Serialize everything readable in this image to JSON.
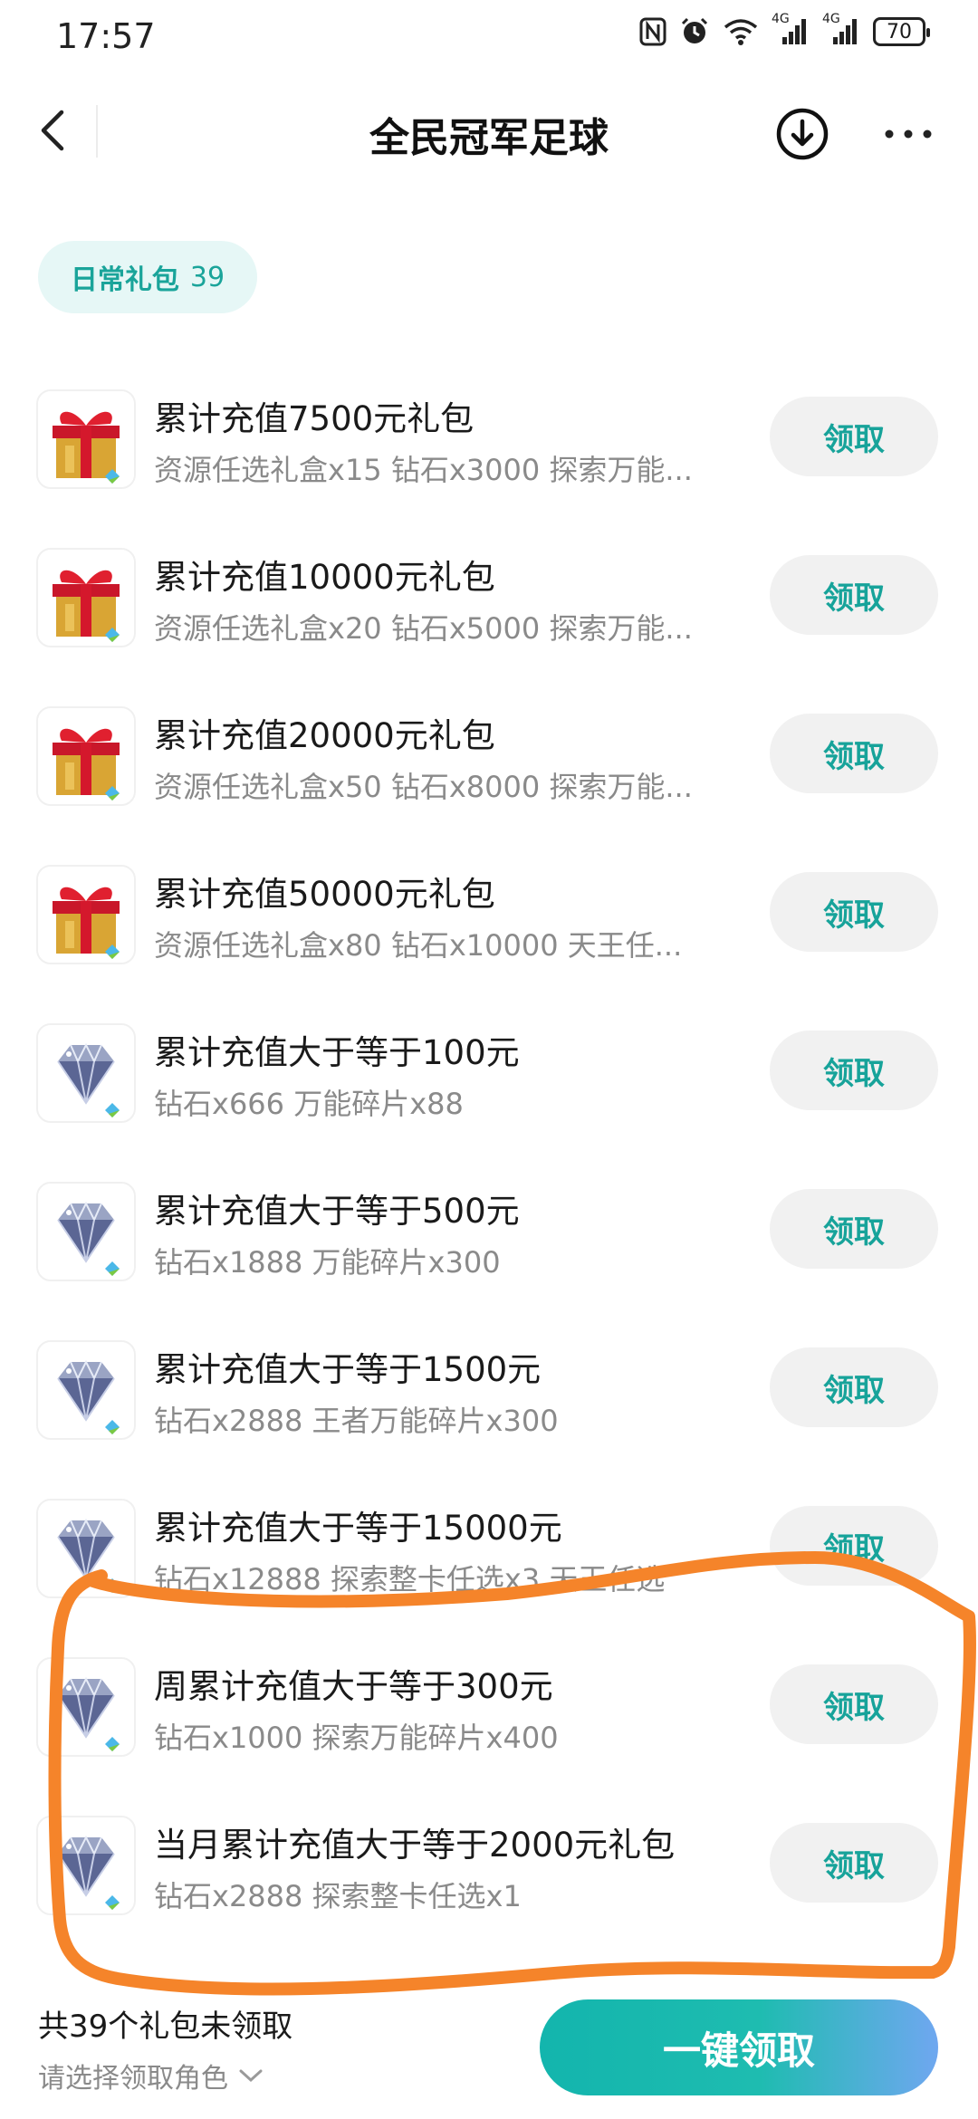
{
  "status_bar": {
    "time": "17:57",
    "battery": "70",
    "signal_labels": [
      "4G",
      "4G"
    ]
  },
  "header": {
    "title": "全民冠军足球"
  },
  "filter_chip": {
    "label": "日常礼包",
    "count": "39"
  },
  "packages": [
    {
      "icon": "gift-box-icon",
      "title": "累计充值7500元礼包",
      "desc": "资源任选礼盒x15 钻石x3000 探索万能...",
      "button": "领取"
    },
    {
      "icon": "gift-box-icon",
      "title": "累计充值10000元礼包",
      "desc": "资源任选礼盒x20 钻石x5000 探索万能...",
      "button": "领取"
    },
    {
      "icon": "gift-box-icon",
      "title": "累计充值20000元礼包",
      "desc": "资源任选礼盒x50 钻石x8000 探索万能...",
      "button": "领取"
    },
    {
      "icon": "gift-box-icon",
      "title": "累计充值50000元礼包",
      "desc": "资源任选礼盒x80 钻石x10000 天王任...",
      "button": "领取"
    },
    {
      "icon": "diamond-icon",
      "title": "累计充值大于等于100元",
      "desc": "钻石x666 万能碎片x88",
      "button": "领取"
    },
    {
      "icon": "diamond-icon",
      "title": "累计充值大于等于500元",
      "desc": "钻石x1888 万能碎片x300",
      "button": "领取"
    },
    {
      "icon": "diamond-icon",
      "title": "累计充值大于等于1500元",
      "desc": "钻石x2888 王者万能碎片x300",
      "button": "领取"
    },
    {
      "icon": "diamond-icon",
      "title": "累计充值大于等于15000元",
      "desc": "钻石x12888 探索整卡任选x3 天王任选",
      "button": "领取"
    },
    {
      "icon": "diamond-icon",
      "title": "周累计充值大于等于300元",
      "desc": "钻石x1000 探索万能碎片x400",
      "button": "领取"
    },
    {
      "icon": "diamond-icon",
      "title": "当月累计充值大于等于2000元礼包",
      "desc": "钻石x2888 探索整卡任选x1",
      "button": "领取"
    }
  ],
  "footer": {
    "unclaimed_text": "共39个礼包未领取",
    "role_select": "请选择领取角色",
    "one_click_button": "一键领取"
  },
  "colors": {
    "accent": "#17a39a",
    "annotation": "#f5842a",
    "chip_bg": "#e6f7f6"
  }
}
